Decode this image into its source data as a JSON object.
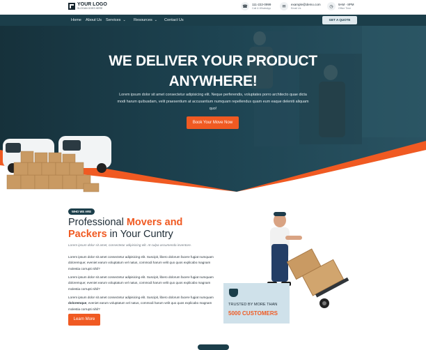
{
  "header": {
    "logo_name": "YOUR LOGO",
    "logo_slogan": "SLOGAN GOES HERE",
    "contacts": [
      {
        "icon": "phone-icon",
        "line1": "111-222-0999",
        "line2": "Call & WhatsApp"
      },
      {
        "icon": "email-icon",
        "line1": "example@demo.com",
        "line2": "Email Us"
      },
      {
        "icon": "clock-icon",
        "line1": "9AM - 8PM",
        "line2": "Office Time"
      }
    ]
  },
  "nav": {
    "items": [
      "Home",
      "About Us",
      "Services",
      "Resources",
      "Contact Us"
    ],
    "quote_label": "GET A QUOTE"
  },
  "hero": {
    "headline_line1": "WE DELIVER YOUR PRODUCT",
    "headline_line2": "ANYWHERE!",
    "text": "Lorem ipsum dolor sit amet consectetur adipisicing elit. Neque perferendis, voluptates porro architecto quae dicta modi harum quibusdam, velit praesentium at accusantium numquam repellendus quam eum eaque deleniti aliquam quo!",
    "button_label": "Book Your Move Now"
  },
  "about": {
    "tag": "WHO WE ARE",
    "title_part1": "Professional ",
    "title_part2": "Movers and Packers",
    "title_part3": " in Your Cuntry",
    "subtitle": "Lorem ipsum dolor sit amet, consectetur adipisicing elit. At culpa assumenda inventore.",
    "paragraph1": "Lorem ipsum dolor sit amet consectetur adipisicing elit. Suscipit, libero dolorum facere fugiat numquam doloremque; eveniet earum voluptatum vel natus, commodi harum velit quo quos explicabo magnam molestia corrupti nihil?",
    "paragraph2": "Lorem ipsum dolor sit amet consectetur adipisicing elit. Suscipit, libero dolorum facere fugiat numquam doloremque; eveniet earum voluptatum vel natus, commodi harum velit quo quos explicabo magnam molestia corrupti nihil?",
    "paragraph3_start": "Lorem ipsum dolor sit amet consectetur adipisicing elit. Suscipit, libero dolorum facere fugiat numquam ",
    "paragraph3_bold": "doloremque",
    "paragraph3_end": ", eveniet earum voluptatum vel natus, commodi harum velit quo quos explicabo magnam molestia corrupti nihil?",
    "button_label": "Learn More"
  },
  "trust": {
    "line1": "TRUSTED BY MORE THAN",
    "line2": "5000 CUSTOMERS"
  },
  "colors": {
    "accent": "#f05a22",
    "primary": "#1b3e4a",
    "trust_bg": "#cfe1ea"
  }
}
